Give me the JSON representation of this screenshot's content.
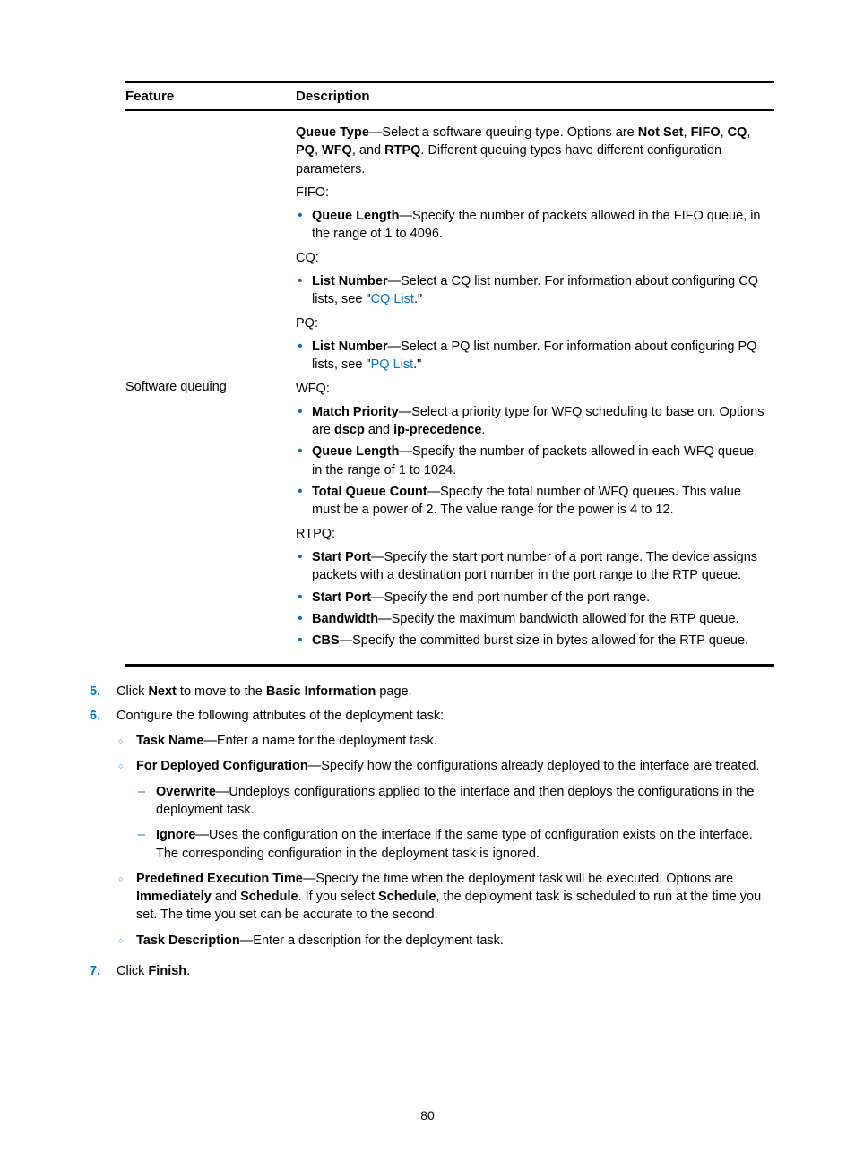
{
  "table": {
    "headers": {
      "feature": "Feature",
      "description": "Description"
    },
    "row": {
      "feature": "Software queuing",
      "queueType_lead": "Queue Type",
      "queueType_rest": "—Select a software queuing type. Options are ",
      "opt_notset": "Not Set",
      "opt_fifo": "FIFO",
      "opt_cq": "CQ",
      "opt_pq": "PQ",
      "opt_wfq": "WFQ",
      "opt_rtpq": "RTPQ",
      "queueType_tail": ". Different queuing types have different configuration parameters.",
      "fifo_h": "FIFO:",
      "fifo_b": "Queue Length",
      "fifo_t": "—Specify the number of packets allowed in the FIFO queue, in the range of 1 to 4096.",
      "cq_h": "CQ:",
      "cq_b": "List Number",
      "cq_t1": "—Select a CQ list number. For information about configuring CQ lists, see \"",
      "cq_link": "CQ List",
      "cq_t2": ".\"",
      "pq_h": "PQ:",
      "pq_b": "List Number",
      "pq_t1": "—Select a PQ list number. For information about configuring PQ lists, see \"",
      "pq_link": "PQ List",
      "pq_t2": ".\"",
      "wfq_h": "WFQ:",
      "wfq1_b": "Match Priority",
      "wfq1_t": "—Select a priority type for WFQ scheduling to base on. Options are ",
      "wfq1_o1": "dscp",
      "wfq1_and": " and ",
      "wfq1_o2": "ip-precedence",
      "wfq1_dot": ".",
      "wfq2_b": "Queue Length",
      "wfq2_t": "—Specify the number of packets allowed in each WFQ queue, in the range of 1 to 1024.",
      "wfq3_b": "Total Queue Count",
      "wfq3_t": "—Specify the total number of WFQ queues. This value must be a power of 2. The value range for the power is 4 to 12.",
      "rtpq_h": "RTPQ:",
      "rtpq1_b": "Start Port",
      "rtpq1_t": "—Specify the start port number of a port range. The device assigns packets with a destination port number in the port range to the RTP queue.",
      "rtpq2_b": "Start Port",
      "rtpq2_t": "—Specify the end port number of the port range.",
      "rtpq3_b": "Bandwidth",
      "rtpq3_t": "—Specify the maximum bandwidth allowed for the RTP queue.",
      "rtpq4_b": "CBS",
      "rtpq4_t": "—Specify the committed burst size in bytes allowed for the RTP queue."
    }
  },
  "steps": {
    "s5_num": "5.",
    "s5_pre": "Click ",
    "s5_b1": "Next",
    "s5_mid": " to move to the ",
    "s5_b2": "Basic Information",
    "s5_tail": " page.",
    "s6_num": "6.",
    "s6_text": "Configure the following attributes of the deployment task:",
    "s6a_b": "Task Name",
    "s6a_t": "—Enter a name for the deployment task.",
    "s6b_b": "For Deployed Configuration",
    "s6b_t": "—Specify how the configurations already deployed to the interface are treated.",
    "s6b1_b": "Overwrite",
    "s6b1_t": "—Undeploys configurations applied to the interface and then deploys the configurations in the deployment task.",
    "s6b2_b": "Ignore",
    "s6b2_t": "—Uses the configuration on the interface if the same type of configuration exists on the interface. The corresponding configuration in the deployment task is ignored.",
    "s6c_b": "Predefined Execution Time",
    "s6c_t1": "—Specify the time when the deployment task will be executed. Options are ",
    "s6c_o1": "Immediately",
    "s6c_and": " and ",
    "s6c_o2": "Schedule",
    "s6c_t2": ". If you select ",
    "s6c_o3": "Schedule",
    "s6c_t3": ", the deployment task is scheduled to run at the time you set. The time you set can be accurate to the second.",
    "s6d_b": "Task Description",
    "s6d_t": "—Enter a description for the deployment task.",
    "s7_num": "7.",
    "s7_pre": "Click ",
    "s7_b": "Finish",
    "s7_tail": "."
  },
  "pagenum": "80"
}
